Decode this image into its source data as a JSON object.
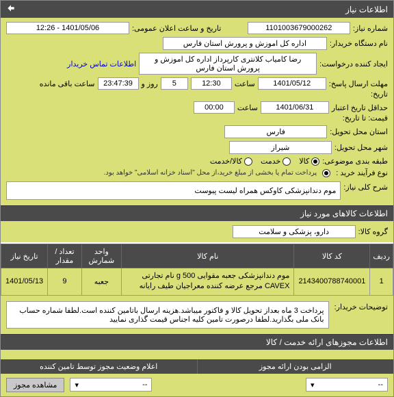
{
  "header": {
    "title": "اطلاعات نیاز"
  },
  "form": {
    "request_no_label": "شماره نیاز:",
    "request_no": "1101003679000262",
    "announce_label": "تاریخ و ساعت اعلان عمومی:",
    "announce_value": "1401/05/06 - 12:26",
    "buyer_org_label": "نام دستگاه خریدار:",
    "buyer_org": "اداره کل اموزش و پرورش استان فارس",
    "requester_label": "ایجاد کننده درخواست:",
    "requester": "رضا کامیاب کلانتری کارپرداز اداره کل اموزش و پرورش استان فارس",
    "contact_link": "اطلاعات تماس خریدار",
    "send_deadline_label": "مهلت ارسال پاسخ:",
    "send_deadline_time_label": "تاریخ:",
    "deadline_date": "1401/05/12",
    "time_label": "ساعت",
    "deadline_time": "12:30",
    "days_remaining": "5",
    "days_label": "روز و",
    "time_remaining": "23:47:39",
    "remaining_label": "ساعت باقی مانده",
    "valid_label": "حداقل تاریخ اعتبار",
    "valid_sub": "قیمت: تا تاریخ:",
    "valid_date": "1401/06/31",
    "valid_time": "00:00",
    "province_label": "استان محل تحویل:",
    "province": "فارس",
    "city_label": "شهر محل تحویل:",
    "city": "شیراز",
    "category_label": "طبقه بندی موضوعی:",
    "cat_goods": "کالا",
    "cat_service": "خدمت",
    "cat_both": "کالا/خدمت",
    "purchase_type_label": "نوع فرآیند خرید :",
    "purchase_note": "پرداخت تمام یا بخشی از مبلغ خرید،از محل \"اسناد خزانه اسلامی\" خواهد بود."
  },
  "need_desc": {
    "label": "شرح کلی نیاز:",
    "text": "موم دندانپزشکی کاوکس همراه لیست پیوست"
  },
  "goods_section": {
    "title": "اطلاعات کالاهای مورد نیاز",
    "group_label": "گروه کالا:",
    "group_value": "دارو، پزشکی و سلامت"
  },
  "table": {
    "headers": {
      "row": "ردیف",
      "code": "کد کالا",
      "name": "نام کالا",
      "unit": "واحد شمارش",
      "qty": "تعداد / مقدار",
      "date": "تاریخ نیاز"
    },
    "rows": [
      {
        "idx": "1",
        "code": "2143400788740001",
        "name": "موم دندانپزشکی جعبه مقوایی 500 g نام تجارتی CAVEX مرجع عرضه کننده معراجیان طیف رایانه",
        "unit": "جعبه",
        "qty": "9",
        "date": "1401/05/13"
      }
    ]
  },
  "buyer_notes": {
    "label": "توضیحات خریدار:",
    "text": "پرداخت 3 ماه بعداز تحویل کالا و فاکتور میباشد.هزینه ارسال باتامین کننده است.لطفا شماره حساب بانک ملی بگذارید.لطفا درصورت تامین کلیه اجناس قیمت گذاری نمایید"
  },
  "permits_section": {
    "title": "اطلاعات مجوزهای ارائه خدمت / کالا"
  },
  "split": {
    "left": "الزامی بودن ارائه مجوز",
    "right": "اعلام وضعیت مجوز توسط تامین کننده"
  },
  "bottom": {
    "sel1": "--",
    "sel2": "--",
    "btn": "مشاهده مجوز"
  }
}
